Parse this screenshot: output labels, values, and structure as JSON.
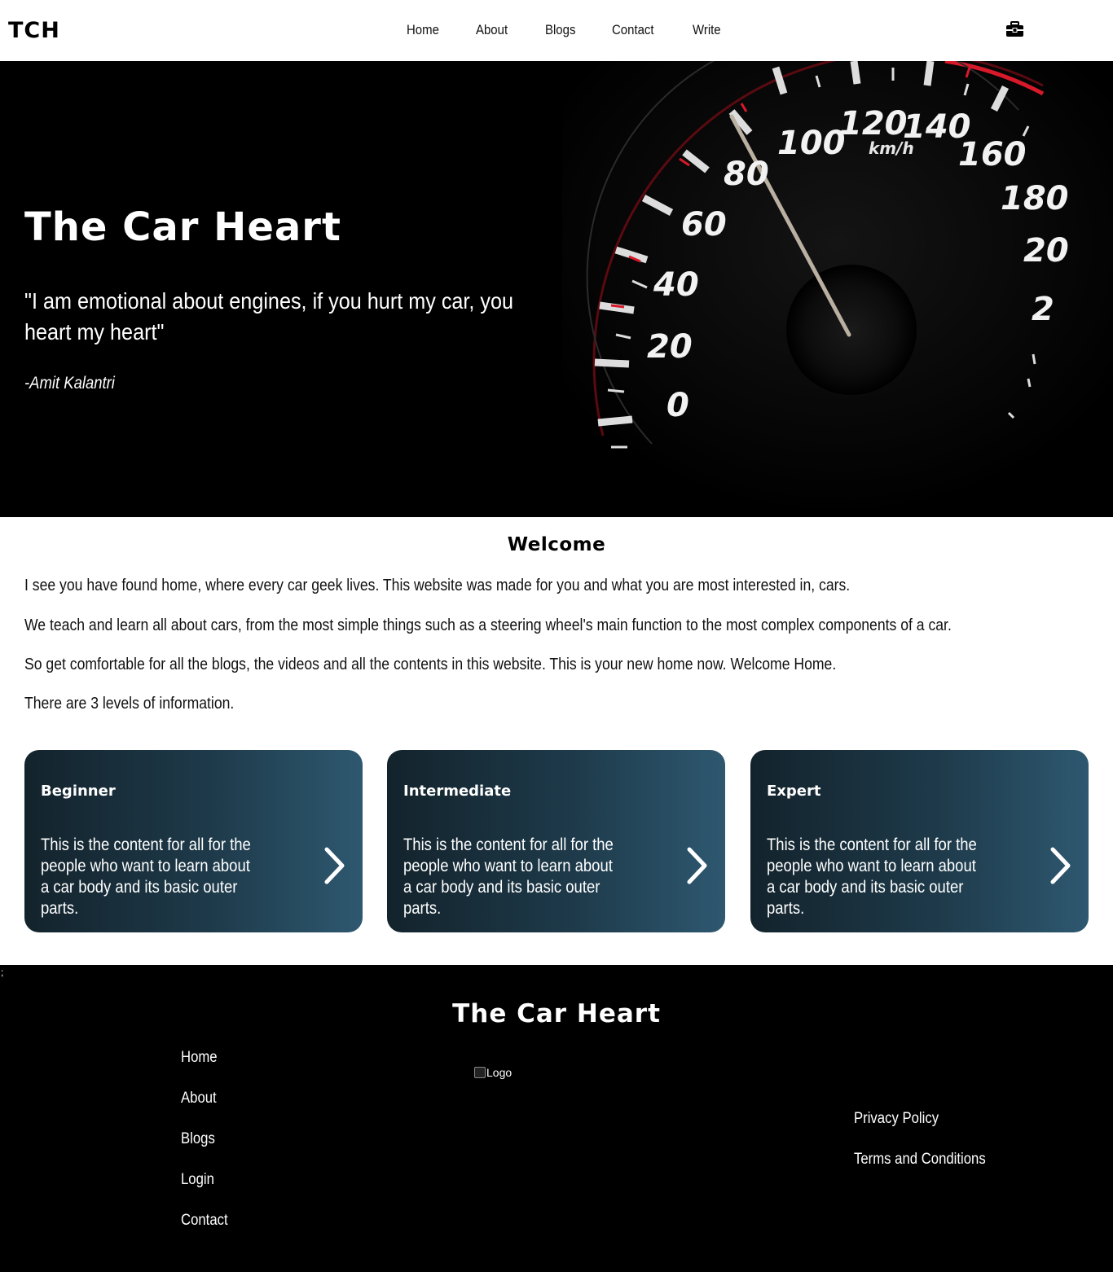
{
  "nav": {
    "brand": "TCH",
    "links": [
      "Home",
      "About",
      "Blogs",
      "Contact",
      "Write"
    ],
    "icon": "toolbox-icon"
  },
  "hero": {
    "title": "The Car Heart",
    "quote": "\"I am emotional about engines, if you hurt my car, you heart my heart\"",
    "author": "-Amit Kalantri",
    "gauge_labels": [
      "0",
      "20",
      "40",
      "60",
      "80",
      "100",
      "120",
      "140",
      "160",
      "180",
      "20",
      "2"
    ],
    "gauge_unit": "km/h"
  },
  "welcome": {
    "title": "Welcome",
    "paragraphs": [
      "I see you have found home, where every car geek lives. This website was made for you and what you are most interested in, cars.",
      "We teach and learn all about cars, from the most simple things such as a steering wheel's main function to the most complex components of a car.",
      "So get comfortable for all the blogs, the videos and all the contents in this website. This is your new home now. Welcome Home.",
      "There are 3 levels of information."
    ]
  },
  "cards": [
    {
      "title": "Beginner",
      "text": "This is the content for all for the people who want to learn about a car body and its basic outer parts."
    },
    {
      "title": "Intermediate",
      "text": "This is the content for all for the people who want to learn about a car body and its basic outer parts."
    },
    {
      "title": "Expert",
      "text": "This is the content for all for the people who want to learn about a car body and its basic outer parts."
    }
  ],
  "footer": {
    "stray": ";",
    "title": "The Car Heart",
    "links": [
      "Home",
      "About",
      "Blogs",
      "Login",
      "Contact"
    ],
    "logo_alt": "Logo",
    "legal": [
      "Privacy Policy",
      "Terms and Conditions"
    ]
  },
  "colors": {
    "card_dark": "#13232c",
    "card_light": "#2e5870",
    "gauge_red": "#d8192a"
  }
}
